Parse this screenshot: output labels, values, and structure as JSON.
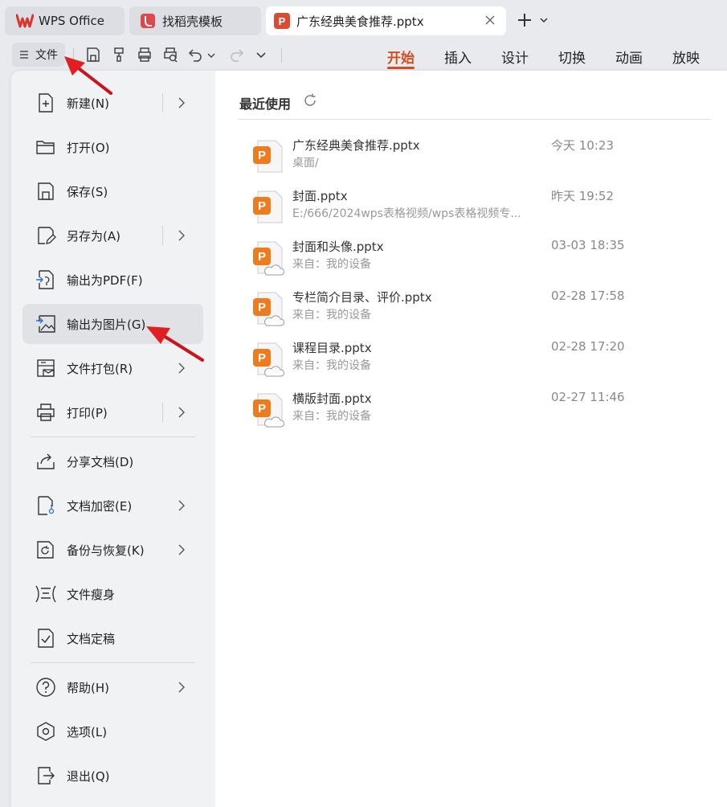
{
  "tabs": [
    {
      "label": "WPS Office"
    },
    {
      "label": "找稻壳模板"
    },
    {
      "label": "广东经典美食推荐.pptx"
    }
  ],
  "toolbar": {
    "file_label": "文件",
    "ribbon_tabs": [
      "开始",
      "插入",
      "设计",
      "切换",
      "动画",
      "放映"
    ],
    "active_tab": "开始"
  },
  "sidebar": {
    "items": [
      {
        "label": "新建(N)",
        "icon": "new-file-icon",
        "has_submenu": true
      },
      {
        "label": "打开(O)",
        "icon": "folder-open-icon",
        "has_submenu": false
      },
      {
        "label": "保存(S)",
        "icon": "save-icon",
        "has_submenu": false
      },
      {
        "label": "另存为(A)",
        "icon": "save-as-icon",
        "has_submenu": true
      },
      {
        "label": "输出为PDF(F)",
        "icon": "export-pdf-icon",
        "has_submenu": false
      },
      {
        "label": "输出为图片(G)",
        "icon": "export-image-icon",
        "has_submenu": false,
        "selected": true
      },
      {
        "label": "文件打包(R)",
        "icon": "package-icon",
        "has_submenu": true
      },
      {
        "label": "打印(P)",
        "icon": "printer-icon",
        "has_submenu": true
      },
      {
        "label": "分享文档(D)",
        "icon": "share-icon",
        "has_submenu": false
      },
      {
        "label": "文档加密(E)",
        "icon": "encrypt-icon",
        "has_submenu": true
      },
      {
        "label": "备份与恢复(K)",
        "icon": "backup-icon",
        "has_submenu": true
      },
      {
        "label": "文件瘦身",
        "icon": "slim-icon",
        "has_submenu": false
      },
      {
        "label": "文档定稿",
        "icon": "finalize-icon",
        "has_submenu": false
      },
      {
        "label": "帮助(H)",
        "icon": "help-icon",
        "has_submenu": true
      },
      {
        "label": "选项(L)",
        "icon": "options-icon",
        "has_submenu": false
      },
      {
        "label": "退出(Q)",
        "icon": "exit-icon",
        "has_submenu": false
      }
    ]
  },
  "recent": {
    "title": "最近使用",
    "files": [
      {
        "name": "广东经典美食推荐.pptx",
        "path": "桌面/",
        "time": "今天 10:23",
        "cloud": false
      },
      {
        "name": "封面.pptx",
        "path": "E:/666/2024wps表格视频/wps表格视频专...",
        "time": "昨天 19:52",
        "cloud": false
      },
      {
        "name": "封面和头像.pptx",
        "path": "来自：我的设备",
        "time": "03-03 18:35",
        "cloud": true
      },
      {
        "name": "专栏简介目录、评价.pptx",
        "path": "来自：我的设备",
        "time": "02-28 17:58",
        "cloud": true
      },
      {
        "name": "课程目录.pptx",
        "path": "来自：我的设备",
        "time": "02-28 17:20",
        "cloud": true
      },
      {
        "name": "横版封面.pptx",
        "path": "来自：我的设备",
        "time": "02-27 11:46",
        "cloud": true
      }
    ]
  },
  "colors": {
    "accent": "#d24e21",
    "ppt_orange": "#ef7b1f",
    "annotation_red": "#e02020"
  }
}
